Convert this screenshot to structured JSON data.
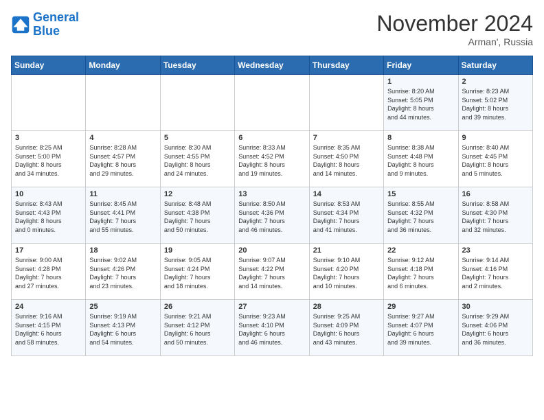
{
  "header": {
    "logo_line1": "General",
    "logo_line2": "Blue",
    "month_title": "November 2024",
    "location": "Arman', Russia"
  },
  "weekdays": [
    "Sunday",
    "Monday",
    "Tuesday",
    "Wednesday",
    "Thursday",
    "Friday",
    "Saturday"
  ],
  "weeks": [
    [
      {
        "day": "",
        "info": ""
      },
      {
        "day": "",
        "info": ""
      },
      {
        "day": "",
        "info": ""
      },
      {
        "day": "",
        "info": ""
      },
      {
        "day": "",
        "info": ""
      },
      {
        "day": "1",
        "info": "Sunrise: 8:20 AM\nSunset: 5:05 PM\nDaylight: 8 hours\nand 44 minutes."
      },
      {
        "day": "2",
        "info": "Sunrise: 8:23 AM\nSunset: 5:02 PM\nDaylight: 8 hours\nand 39 minutes."
      }
    ],
    [
      {
        "day": "3",
        "info": "Sunrise: 8:25 AM\nSunset: 5:00 PM\nDaylight: 8 hours\nand 34 minutes."
      },
      {
        "day": "4",
        "info": "Sunrise: 8:28 AM\nSunset: 4:57 PM\nDaylight: 8 hours\nand 29 minutes."
      },
      {
        "day": "5",
        "info": "Sunrise: 8:30 AM\nSunset: 4:55 PM\nDaylight: 8 hours\nand 24 minutes."
      },
      {
        "day": "6",
        "info": "Sunrise: 8:33 AM\nSunset: 4:52 PM\nDaylight: 8 hours\nand 19 minutes."
      },
      {
        "day": "7",
        "info": "Sunrise: 8:35 AM\nSunset: 4:50 PM\nDaylight: 8 hours\nand 14 minutes."
      },
      {
        "day": "8",
        "info": "Sunrise: 8:38 AM\nSunset: 4:48 PM\nDaylight: 8 hours\nand 9 minutes."
      },
      {
        "day": "9",
        "info": "Sunrise: 8:40 AM\nSunset: 4:45 PM\nDaylight: 8 hours\nand 5 minutes."
      }
    ],
    [
      {
        "day": "10",
        "info": "Sunrise: 8:43 AM\nSunset: 4:43 PM\nDaylight: 8 hours\nand 0 minutes."
      },
      {
        "day": "11",
        "info": "Sunrise: 8:45 AM\nSunset: 4:41 PM\nDaylight: 7 hours\nand 55 minutes."
      },
      {
        "day": "12",
        "info": "Sunrise: 8:48 AM\nSunset: 4:38 PM\nDaylight: 7 hours\nand 50 minutes."
      },
      {
        "day": "13",
        "info": "Sunrise: 8:50 AM\nSunset: 4:36 PM\nDaylight: 7 hours\nand 46 minutes."
      },
      {
        "day": "14",
        "info": "Sunrise: 8:53 AM\nSunset: 4:34 PM\nDaylight: 7 hours\nand 41 minutes."
      },
      {
        "day": "15",
        "info": "Sunrise: 8:55 AM\nSunset: 4:32 PM\nDaylight: 7 hours\nand 36 minutes."
      },
      {
        "day": "16",
        "info": "Sunrise: 8:58 AM\nSunset: 4:30 PM\nDaylight: 7 hours\nand 32 minutes."
      }
    ],
    [
      {
        "day": "17",
        "info": "Sunrise: 9:00 AM\nSunset: 4:28 PM\nDaylight: 7 hours\nand 27 minutes."
      },
      {
        "day": "18",
        "info": "Sunrise: 9:02 AM\nSunset: 4:26 PM\nDaylight: 7 hours\nand 23 minutes."
      },
      {
        "day": "19",
        "info": "Sunrise: 9:05 AM\nSunset: 4:24 PM\nDaylight: 7 hours\nand 18 minutes."
      },
      {
        "day": "20",
        "info": "Sunrise: 9:07 AM\nSunset: 4:22 PM\nDaylight: 7 hours\nand 14 minutes."
      },
      {
        "day": "21",
        "info": "Sunrise: 9:10 AM\nSunset: 4:20 PM\nDaylight: 7 hours\nand 10 minutes."
      },
      {
        "day": "22",
        "info": "Sunrise: 9:12 AM\nSunset: 4:18 PM\nDaylight: 7 hours\nand 6 minutes."
      },
      {
        "day": "23",
        "info": "Sunrise: 9:14 AM\nSunset: 4:16 PM\nDaylight: 7 hours\nand 2 minutes."
      }
    ],
    [
      {
        "day": "24",
        "info": "Sunrise: 9:16 AM\nSunset: 4:15 PM\nDaylight: 6 hours\nand 58 minutes."
      },
      {
        "day": "25",
        "info": "Sunrise: 9:19 AM\nSunset: 4:13 PM\nDaylight: 6 hours\nand 54 minutes."
      },
      {
        "day": "26",
        "info": "Sunrise: 9:21 AM\nSunset: 4:12 PM\nDaylight: 6 hours\nand 50 minutes."
      },
      {
        "day": "27",
        "info": "Sunrise: 9:23 AM\nSunset: 4:10 PM\nDaylight: 6 hours\nand 46 minutes."
      },
      {
        "day": "28",
        "info": "Sunrise: 9:25 AM\nSunset: 4:09 PM\nDaylight: 6 hours\nand 43 minutes."
      },
      {
        "day": "29",
        "info": "Sunrise: 9:27 AM\nSunset: 4:07 PM\nDaylight: 6 hours\nand 39 minutes."
      },
      {
        "day": "30",
        "info": "Sunrise: 9:29 AM\nSunset: 4:06 PM\nDaylight: 6 hours\nand 36 minutes."
      }
    ]
  ]
}
